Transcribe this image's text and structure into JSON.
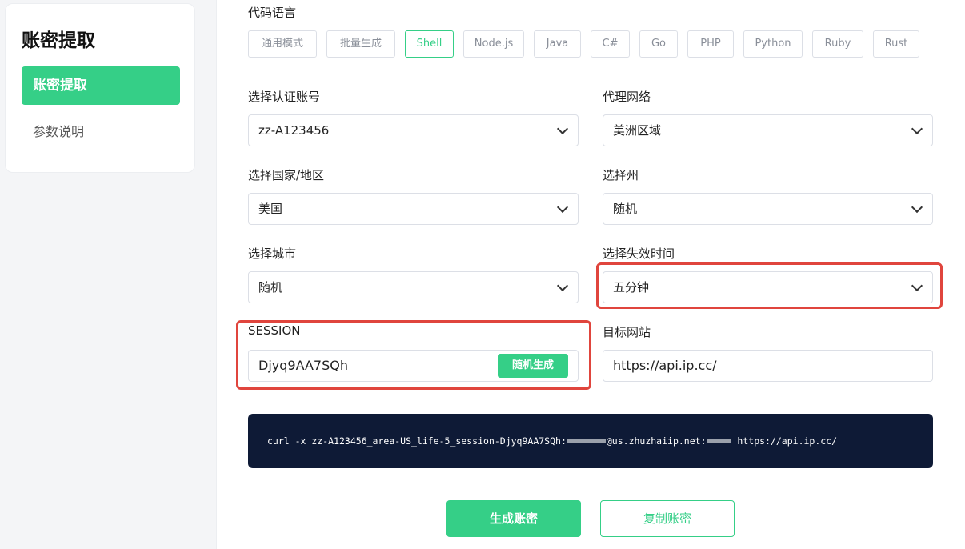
{
  "sidebar": {
    "title": "账密提取",
    "items": [
      {
        "label": "账密提取",
        "active": true
      },
      {
        "label": "参数说明",
        "active": false
      }
    ]
  },
  "form": {
    "language_label": "代码语言",
    "languages": [
      "通用模式",
      "批量生成",
      "Shell",
      "Node.js",
      "Java",
      "C#",
      "Go",
      "PHP",
      "Python",
      "Ruby",
      "Rust"
    ],
    "active_language": "Shell",
    "account": {
      "label": "选择认证账号",
      "value": "zz-A123456"
    },
    "proxy": {
      "label": "代理网络",
      "value": "美洲区域"
    },
    "country": {
      "label": "选择国家/地区",
      "value": "美国"
    },
    "state": {
      "label": "选择州",
      "value": "随机"
    },
    "city": {
      "label": "选择城市",
      "value": "随机"
    },
    "expiry": {
      "label": "选择失效时间",
      "value": "五分钟"
    },
    "session": {
      "label": "SESSION",
      "value": "Djyq9AA7SQh",
      "random_button": "随机生成"
    },
    "target": {
      "label": "目标网站",
      "value": "https://api.ip.cc/"
    }
  },
  "command": {
    "prefix": "curl -x zz-A123456_area-US_life-5_session-Djyq9AA7SQh:",
    "host": "@us.zhuzhaiip.net:",
    "url": " https://api.ip.cc/"
  },
  "buttons": {
    "generate": "生成账密",
    "copy": "复制账密"
  },
  "colors": {
    "accent": "#35cf87",
    "highlight": "#e0453d",
    "command_bg": "#0e1a36"
  }
}
